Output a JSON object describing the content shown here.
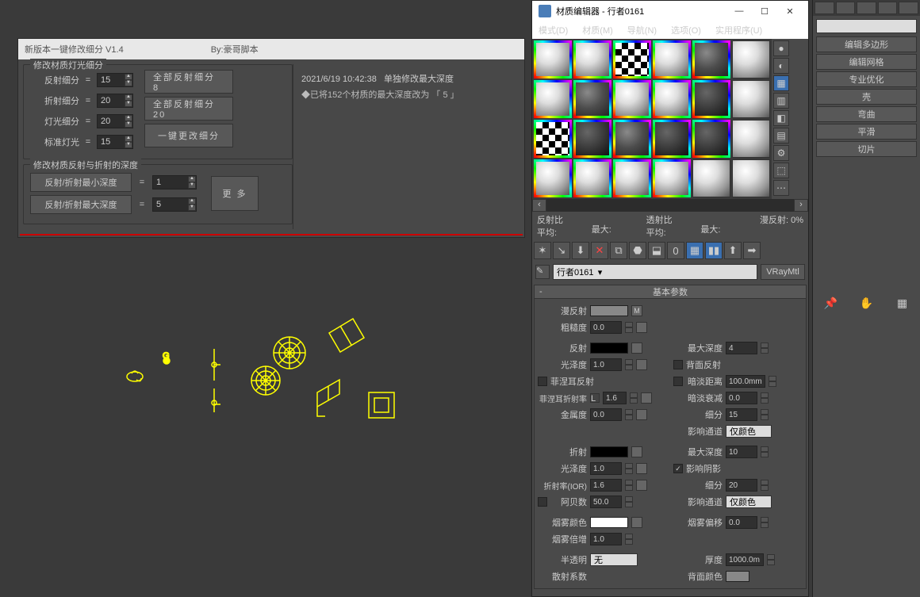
{
  "script": {
    "title": "新版本一键修改细分 V1.4",
    "by": "By:豪哥脚本",
    "group1_title": "修改材质灯光细分",
    "rows": [
      {
        "label": "反射细分",
        "val": "15"
      },
      {
        "label": "折射细分",
        "val": "20"
      },
      {
        "label": "灯光细分",
        "val": "20"
      },
      {
        "label": "标准灯光",
        "val": "15"
      }
    ],
    "btn1": "全部反射细分 8",
    "btn2": "全部反射细分 20",
    "btn3": "一键更改细分",
    "group2_title": "修改材质反射与折射的深度",
    "depth_min_label": "反射/折射最小深度",
    "depth_min": "1",
    "depth_max_label": "反射/折射最大深度",
    "depth_max": "5",
    "more": "更 多",
    "log_ts": "2021/6/19 10:42:38",
    "log_event": "单独修改最大深度",
    "log_line": "◆已将152个材质的最大深度改为 「 5 」"
  },
  "matEditor": {
    "title": "材质编辑器 - 行者0161",
    "menu": [
      "模式(D)",
      "材质(M)",
      "导航(N)",
      "选项(O)",
      "实用程序(U)"
    ],
    "stats": {
      "reflect": "反射比",
      "avg1": "平均:",
      "max1": "最大:",
      "transmit": "透射比",
      "avg2": "平均:",
      "max2": "最大:",
      "diffuse": "漫反射:",
      "pct": "0%"
    },
    "name": "行者0161",
    "type": "VRayMtl",
    "rollout": "基本参数",
    "params": {
      "diffuse_l": "漫反射",
      "m": "M",
      "rough_l": "粗糙度",
      "rough": "0.0",
      "reflect_l": "反射",
      "maxdepth_l": "最大深度",
      "maxdepth": "4",
      "gloss_l": "光泽度",
      "gloss": "1.0",
      "backface_l": "背面反射",
      "fresnel_l": "菲涅耳反射",
      "dimdist_l": "暗淡距离",
      "dimdist": "100.0mm",
      "fresnelior_l": "菲涅耳折射率",
      "fresnelior": "1.6",
      "dimfall_l": "暗淡衰减",
      "dimfall": "0.0",
      "metal_l": "金属度",
      "metal": "0.0",
      "subdiv_l": "细分",
      "subdiv": "15",
      "affect_l": "影响通道",
      "affect": "仅颜色",
      "refract_l": "折射",
      "refr_maxdepth": "10",
      "refr_gloss": "1.0",
      "affectshadow_l": "影响阴影",
      "ior_l": "折射率(IOR)",
      "ior": "1.6",
      "refr_subdiv": "20",
      "abbe_l": "阿贝数",
      "abbe": "50.0",
      "refr_affect": "仅颜色",
      "fogcolor_l": "烟雾颜色",
      "fogbias_l": "烟雾偏移",
      "fogbias": "0.0",
      "fogmult_l": "烟雾倍增",
      "fogmult": "1.0",
      "transl_l": "半透明",
      "transl": "无",
      "thick_l": "厚度",
      "thick": "1000.0m",
      "scatter_l": "散射系数",
      "backcolor_l": "背面颜色"
    }
  },
  "cmd": {
    "buttons": [
      "编辑多边形",
      "编辑网格",
      "专业优化",
      "壳",
      "弯曲",
      "平滑",
      "切片"
    ]
  }
}
